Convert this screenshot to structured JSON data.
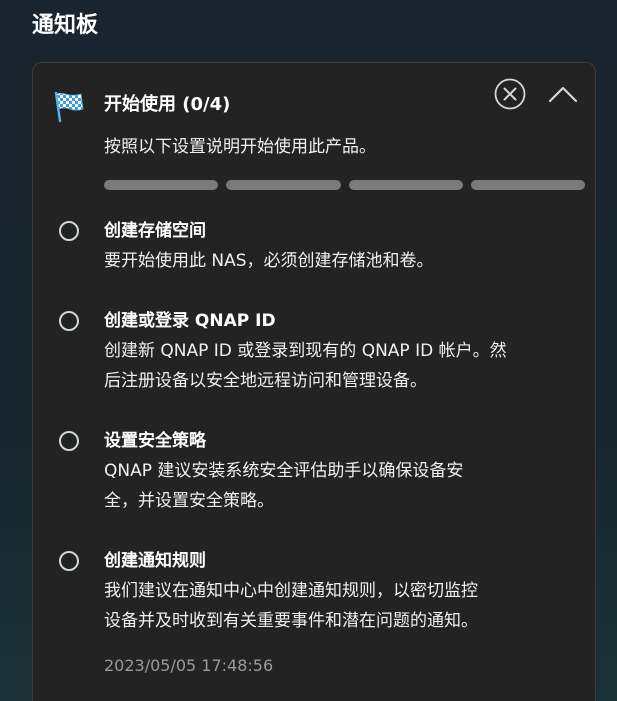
{
  "page": {
    "title": "通知板"
  },
  "card": {
    "title": "开始使用 (0/4)",
    "description": "按照以下设置说明开始使用此产品。",
    "progress": {
      "completed": 0,
      "total": 4
    },
    "icons": {
      "header": "checkered-flag-icon",
      "close": "close-circle-icon",
      "collapse": "chevron-up-icon"
    },
    "tasks": [
      {
        "title": "创建存储空间",
        "lines": [
          "要开始使用此 NAS，必须创建存储池和卷。"
        ]
      },
      {
        "title": "创建或登录 QNAP ID",
        "lines": [
          "创建新 QNAP ID 或登录到现有的 QNAP ID 帐户。然",
          "后注册设备以安全地远程访问和管理设备。"
        ]
      },
      {
        "title": "设置安全策略",
        "lines": [
          "QNAP 建议安装系统安全评估助手以确保设备安",
          "全，并设置安全策略。"
        ]
      },
      {
        "title": "创建通知规则",
        "lines": [
          "我们建议在通知中心中创建通知规则，以密切监控",
          "设备并及时收到有关重要事件和潜在问题的通知。"
        ]
      }
    ],
    "timestamp": "2023/05/05 17:48:56"
  },
  "colors": {
    "card_background": "#232323",
    "progress_segment": "#7b7b7b",
    "muted_text": "#9a9a9a",
    "radio_border": "#cfd8dc"
  }
}
